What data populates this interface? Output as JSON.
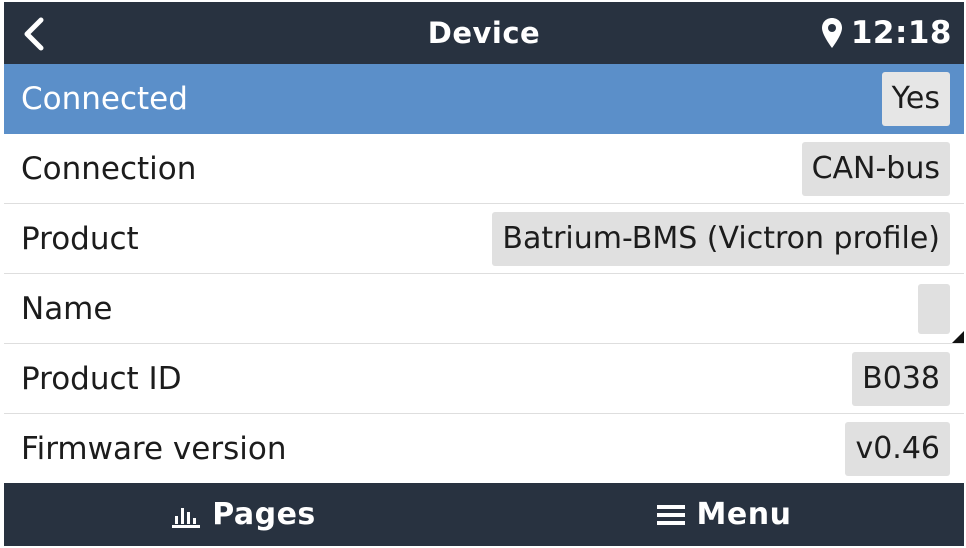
{
  "header": {
    "title": "Device",
    "time": "12:18",
    "back_icon": "chevron-left-icon",
    "location_icon": "location-pin-icon"
  },
  "rows": [
    {
      "label": "Connected",
      "value": "Yes",
      "selected": true
    },
    {
      "label": "Connection",
      "value": "CAN-bus"
    },
    {
      "label": "Product",
      "value": "Batrium-BMS (Victron profile)"
    },
    {
      "label": "Name",
      "value": ""
    },
    {
      "label": "Product ID",
      "value": "B038"
    },
    {
      "label": "Firmware version",
      "value": "v0.46"
    }
  ],
  "footer": {
    "pages_label": "Pages",
    "menu_label": "Menu",
    "pages_icon": "bar-chart-icon",
    "menu_icon": "hamburger-menu-icon"
  },
  "colors": {
    "bar_background": "#283240",
    "selected_row": "#5b8fc9",
    "value_box": "#e0e0e0"
  }
}
